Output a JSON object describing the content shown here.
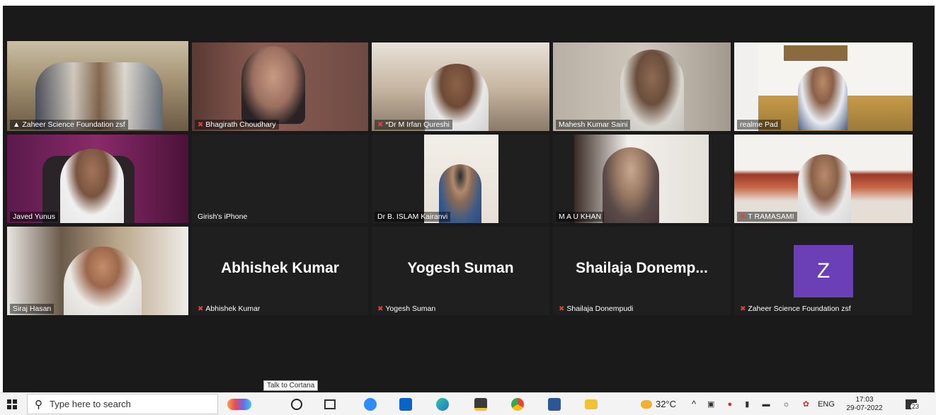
{
  "participants": [
    {
      "name": "Zaheer Science Foundation zsf",
      "icon": "pin-icon"
    },
    {
      "name": "Bhagirath Choudhary",
      "muted": true
    },
    {
      "name": "*Dr M Irfan Qureshi",
      "muted": true
    },
    {
      "name": "Mahesh Kumar Saini"
    },
    {
      "name": "realme Pad"
    },
    {
      "name": "Javed Yunus"
    },
    {
      "name": "Girish's iPhone"
    },
    {
      "name": "Dr B. ISLAM Kairanvi"
    },
    {
      "name": "M A U KHAN"
    },
    {
      "name": "T RAMASAMI",
      "muted": true
    },
    {
      "name": "Siraj Hasan"
    },
    {
      "name": "Abhishek Kumar",
      "display": "Abhishek Kumar",
      "muted": true
    },
    {
      "name": "Yogesh Suman",
      "display": "Yogesh Suman",
      "muted": true
    },
    {
      "name": "Shailaja Donempudi",
      "display": "Shailaja  Donemp...",
      "muted": true
    },
    {
      "name": "Zaheer Science Foundation zsf",
      "avatar_letter": "Z",
      "muted": true
    }
  ],
  "taskbar": {
    "search_placeholder": "Type here to search",
    "tooltip": "Talk to Cortana",
    "weather": "32°C",
    "language": "ENG",
    "time": "17:03",
    "date": "29-07-2022",
    "notification_count": "23"
  },
  "colors": {
    "active_speaker": "#dde35a",
    "avatar_bg": "#6b3fb6",
    "muted_mic": "#e0413a"
  }
}
